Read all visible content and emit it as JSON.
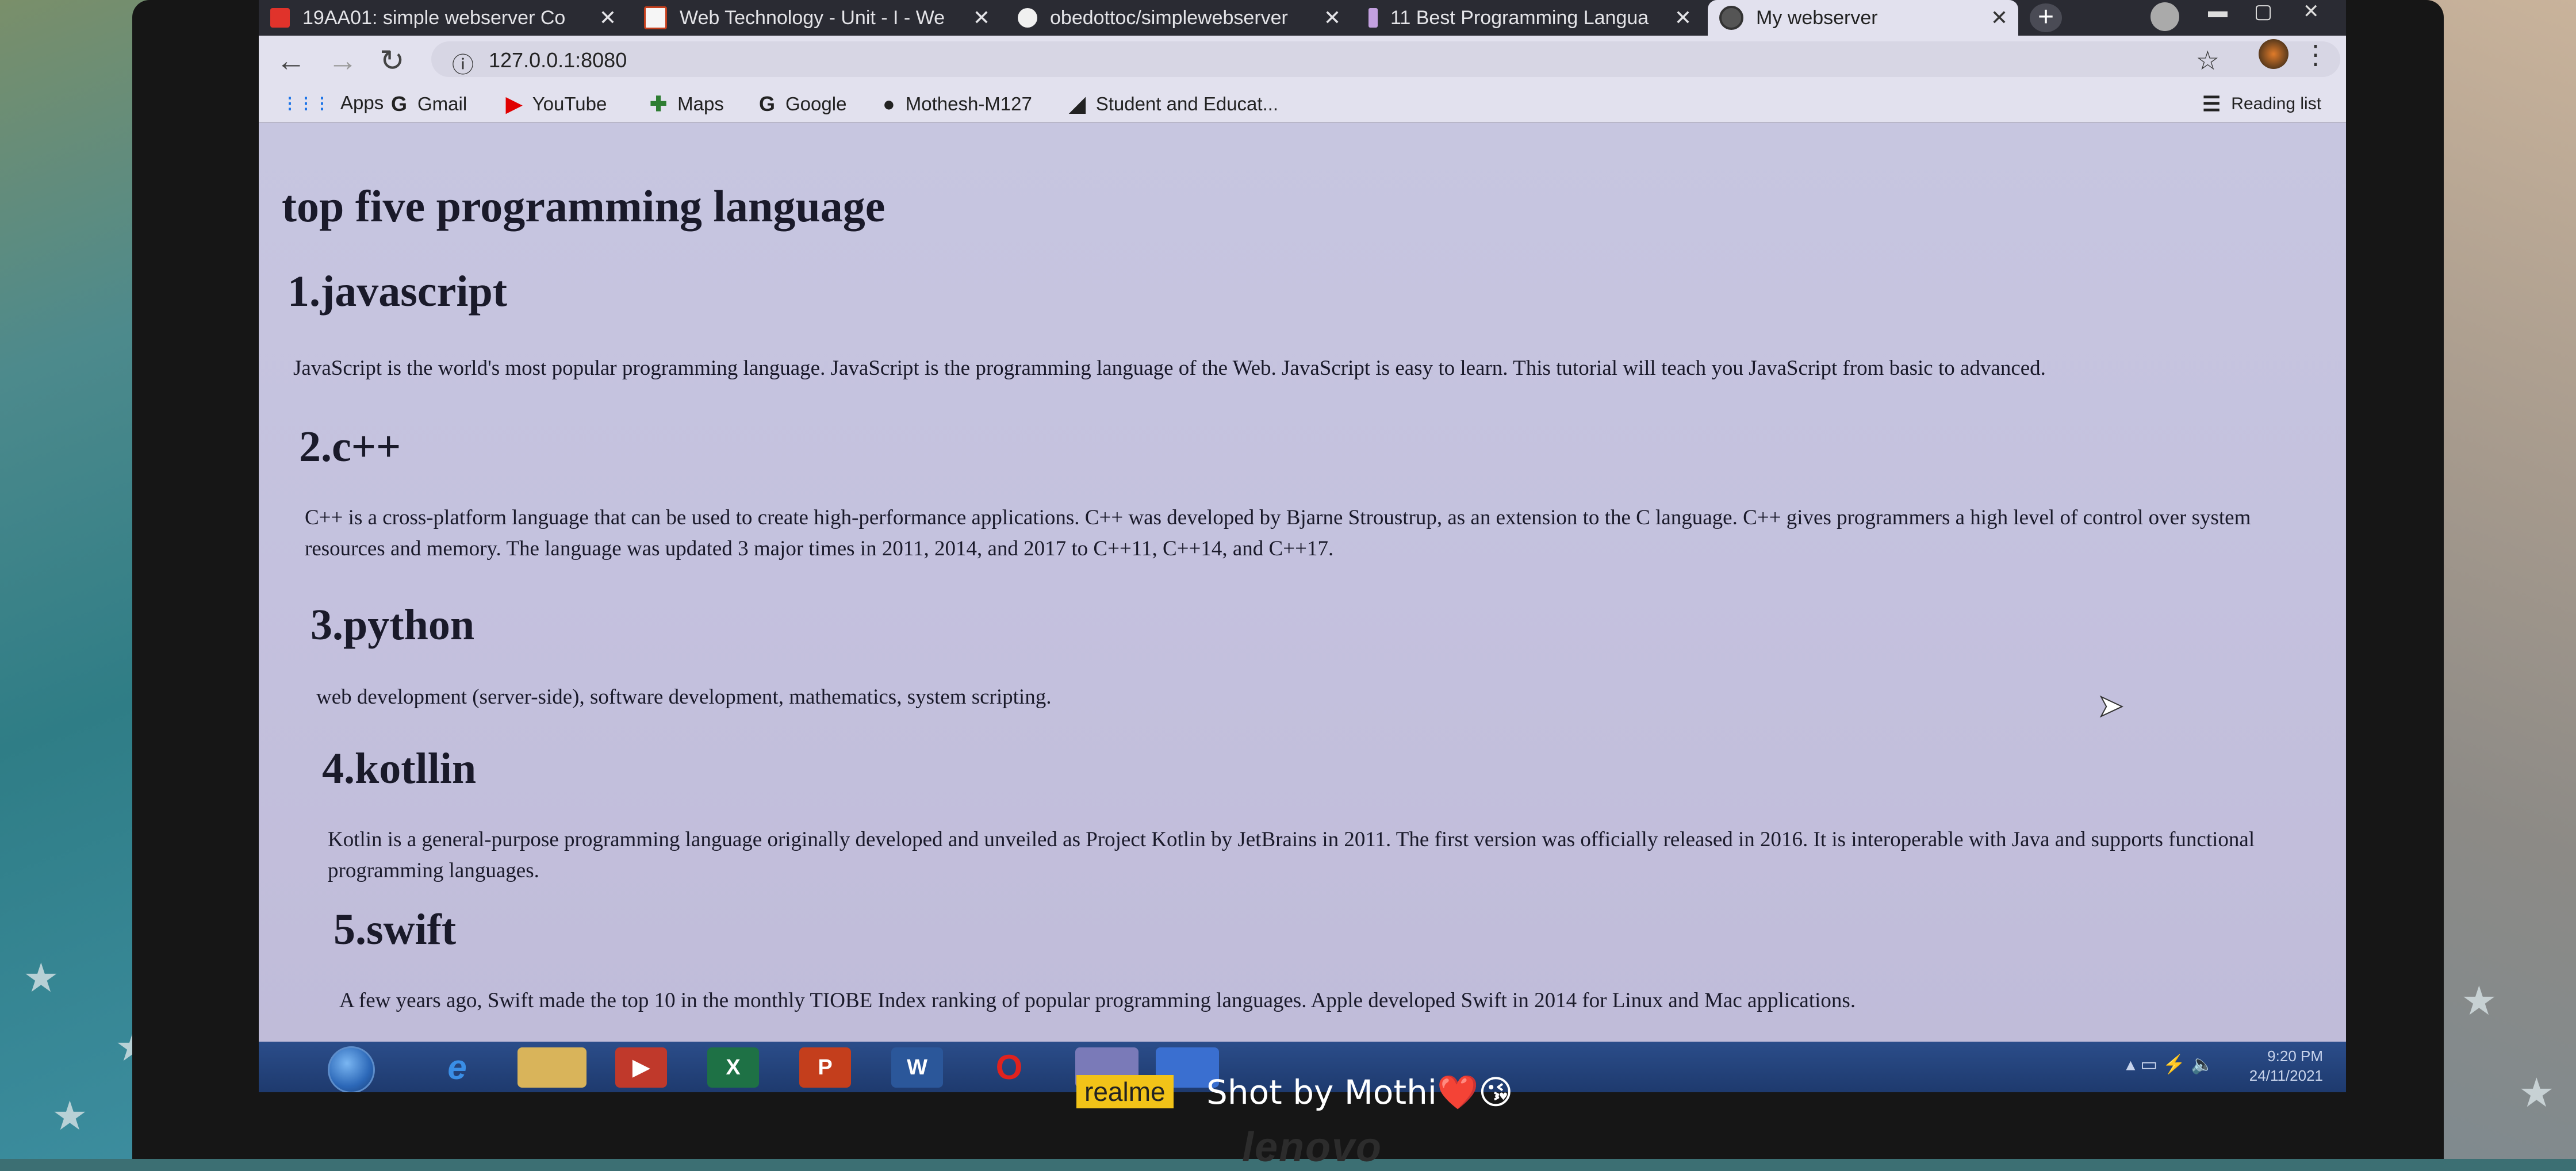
{
  "browser": {
    "tabs": [
      {
        "title": "19AA01: simple webserver Co",
        "icon": "document-icon"
      },
      {
        "title": "Web Technology - Unit - I - We",
        "icon": "slides-icon"
      },
      {
        "title": "obedottoc/simplewebserver",
        "icon": "github-icon"
      },
      {
        "title": "11 Best Programming Langua",
        "icon": "bookmark-icon"
      },
      {
        "title": "My webserver",
        "icon": "globe-icon",
        "active": true
      }
    ],
    "tab_close": "✕",
    "new_tab": "+",
    "url": "127.0.0.1:8080",
    "bookmarks": [
      {
        "label": "Apps",
        "icon": "apps-grid-icon",
        "glyph": "⋮⋮⋮",
        "color": "#1a73e8"
      },
      {
        "label": "Gmail",
        "icon": "google-icon",
        "glyph": "G",
        "color": "#333333"
      },
      {
        "label": "YouTube",
        "icon": "youtube-icon",
        "glyph": "▶",
        "color": "#e00000"
      },
      {
        "label": "Maps",
        "icon": "maps-icon",
        "glyph": "✚",
        "color": "#2e7d32"
      },
      {
        "label": "Google",
        "icon": "google-icon",
        "glyph": "G",
        "color": "#333333"
      },
      {
        "label": "Mothesh-M127",
        "icon": "github-icon",
        "glyph": "●",
        "color": "#111111"
      },
      {
        "label": "Student and Educat...",
        "icon": "classroom-icon",
        "glyph": "◢",
        "color": "#111111"
      }
    ],
    "reading_list": "Reading list"
  },
  "page": {
    "title": "top five programming language",
    "languages": [
      {
        "heading": "1.javascript",
        "text": "JavaScript is the world's most popular programming language. JavaScript is the programming language of the Web. JavaScript is easy to learn. This tutorial will teach you JavaScript from basic to advanced."
      },
      {
        "heading": "2.c++",
        "text": "C++ is a cross-platform language that can be used to create high-performance applications. C++ was developed by Bjarne Stroustrup, as an extension to the C language. C++ gives programmers a high level of control over system resources and memory. The language was updated 3 major times in 2011, 2014, and 2017 to C++11, C++14, and C++17."
      },
      {
        "heading": "3.python",
        "text": "web development (server-side), software development, mathematics, system scripting."
      },
      {
        "heading": "4.kotllin",
        "text": "Kotlin is a general-purpose programming language originally developed and unveiled as Project Kotlin by JetBrains in 2011. The first version was officially released in 2016. It is interoperable with Java and supports functional programming languages."
      },
      {
        "heading": "5.swift",
        "text": "A few years ago, Swift made the top 10 in the monthly TIOBE Index ranking of popular programming languages. Apple developed Swift in 2014 for Linux and Mac applications."
      }
    ]
  },
  "taskbar": {
    "apps": [
      {
        "name": "internet-explorer",
        "label": "e",
        "color": "#3a8ee6"
      },
      {
        "name": "file-explorer",
        "label": "",
        "color": "#d9b45a"
      },
      {
        "name": "media-player",
        "label": "▶",
        "color": "#c0392b"
      },
      {
        "name": "excel",
        "label": "X",
        "color": "#1e7145"
      },
      {
        "name": "powerpoint",
        "label": "P",
        "color": "#c43e1c"
      },
      {
        "name": "word",
        "label": "W",
        "color": "#2b579a"
      },
      {
        "name": "opera",
        "label": "O",
        "color": "#e0221e"
      },
      {
        "name": "chrome",
        "label": "",
        "color": "#7a7ab8"
      },
      {
        "name": "network-app",
        "label": "",
        "color": "#3a6fd0"
      }
    ],
    "time": "9:20 PM",
    "date": "24/11/2021"
  },
  "watermark": {
    "brand": "realme",
    "text": "Shot by Mothi❤️😘"
  },
  "laptop_brand": "lenovo"
}
